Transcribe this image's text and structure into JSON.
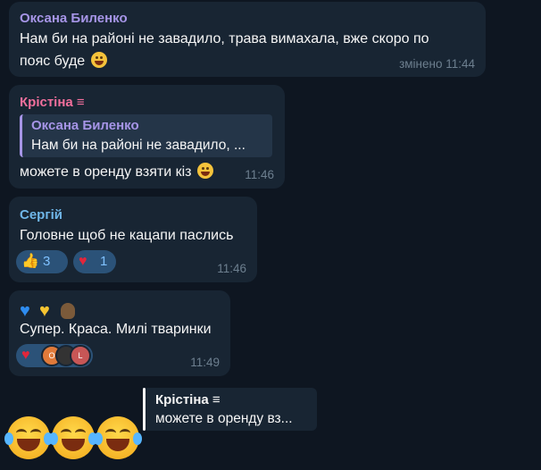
{
  "messages": [
    {
      "sender": "Оксана Биленко",
      "sender_color": "#a695e7",
      "text": "Нам би на районі не завадило, трава вимахала, вже скоро по",
      "text_line2": "пояс буде",
      "emoji": "smiling-sweat",
      "time": "змінено 11:44"
    },
    {
      "sender": "Крістіна ≡",
      "sender_color": "#f16f9c",
      "reply_to": {
        "sender": "Оксана Биленко",
        "text": "Нам би на районі не завадило, ..."
      },
      "text": "можете в оренду взяти кіз",
      "emoji": "grinning",
      "time": "11:46"
    },
    {
      "sender": "Сергій",
      "sender_color": "#6fb6e8",
      "text": "Головне щоб не кацапи паслись",
      "reactions": [
        {
          "icon": "thumbs-up",
          "glyph": "👍",
          "count": "3"
        },
        {
          "icon": "heart",
          "glyph": "♥",
          "count": "1"
        }
      ],
      "time": "11:46"
    },
    {
      "emoji_line": [
        "blue-heart",
        "yellow-heart",
        "owl"
      ],
      "text": "Супер. Краса. Милі тваринки",
      "reaction_avatars": [
        {
          "label": "O",
          "color": "#e07a3a"
        },
        {
          "label": "",
          "color": "#333333"
        },
        {
          "label": "L",
          "color": "#c75656"
        }
      ],
      "time": "11:49"
    }
  ],
  "composer_reply": {
    "sender": "Крістіна ≡",
    "text": "можете в оренду вз..."
  },
  "big_emoji": [
    "tears-of-joy",
    "tears-of-joy",
    "tears-of-joy"
  ]
}
